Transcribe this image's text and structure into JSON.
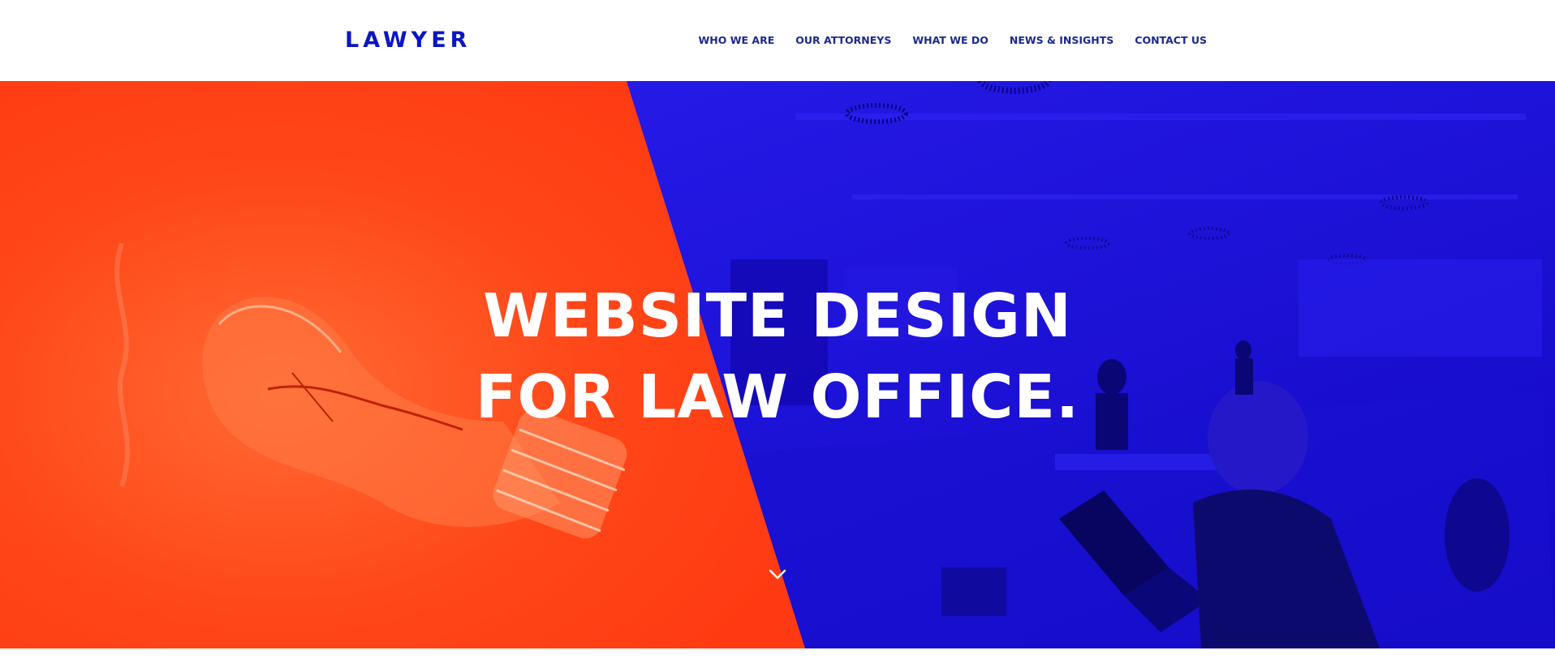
{
  "header": {
    "logo": "LAWYER",
    "nav": [
      {
        "label": "WHO WE ARE"
      },
      {
        "label": "OUR ATTORNEYS"
      },
      {
        "label": "WHAT WE DO"
      },
      {
        "label": "NEWS & INSIGHTS"
      },
      {
        "label": "CONTACT US"
      }
    ]
  },
  "hero": {
    "title_line_1": "WEBSITE DESIGN",
    "title_line_2": "FOR LAW OFFICE.",
    "left_panel_color": "#ff3d14",
    "right_panel_color": "#1b10e0",
    "left_image_icon": "lightbulb-image",
    "right_image_icon": "office-image",
    "scroll_icon": "chevron-down-icon"
  },
  "colors": {
    "brand_blue": "#0b16c4",
    "nav_text": "#1a2a8f",
    "hero_text": "#ffffff"
  }
}
